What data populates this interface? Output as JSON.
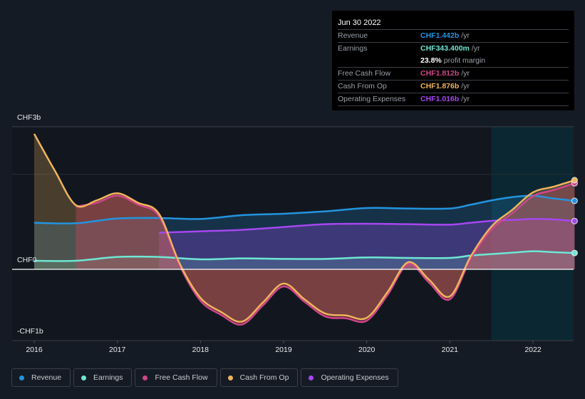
{
  "tooltip": {
    "date": "Jun 30 2022",
    "rows": [
      {
        "label": "Revenue",
        "value": "CHF1.442b",
        "unit": "/yr",
        "color": "#2394df"
      },
      {
        "label": "Earnings",
        "value": "CHF343.400m",
        "unit": "/yr",
        "color": "#6ee7d4"
      },
      {
        "label": "",
        "value": "23.8%",
        "unit": "profit margin",
        "color": "#ffffff"
      },
      {
        "label": "Free Cash Flow",
        "value": "CHF1.812b",
        "unit": "/yr",
        "color": "#d0468a"
      },
      {
        "label": "Cash From Op",
        "value": "CHF1.876b",
        "unit": "/yr",
        "color": "#f0b45c"
      },
      {
        "label": "Operating Expenses",
        "value": "CHF1.016b",
        "unit": "/yr",
        "color": "#a547f0"
      }
    ]
  },
  "chart_data": {
    "type": "area",
    "title": "",
    "xlabel": "",
    "ylabel": "",
    "y_tick_labels": [
      "CHF3b",
      "CHF0",
      "-CHF1b"
    ],
    "y_ticks": [
      3,
      0,
      -1
    ],
    "ylim": [
      -1.5,
      3
    ],
    "x_tick_labels": [
      "2016",
      "2017",
      "2018",
      "2019",
      "2020",
      "2021",
      "2022"
    ],
    "x_ticks": [
      2016,
      2017,
      2018,
      2019,
      2020,
      2021,
      2022
    ],
    "xlim": [
      2015.7,
      2022.5
    ],
    "grid": true,
    "legend_position": "bottom",
    "highlight_start": 2021.5,
    "unit": "CHF billions",
    "series": [
      {
        "name": "Revenue",
        "color": "#2394df",
        "start": 2016.0,
        "x": [
          2016.0,
          2016.5,
          2017.0,
          2017.5,
          2018.0,
          2018.5,
          2019.0,
          2019.5,
          2020.0,
          2020.5,
          2021.0,
          2021.25,
          2021.5,
          2021.75,
          2022.0,
          2022.25,
          2022.5
        ],
        "values": [
          0.98,
          0.97,
          1.07,
          1.08,
          1.06,
          1.14,
          1.17,
          1.22,
          1.29,
          1.28,
          1.28,
          1.36,
          1.45,
          1.52,
          1.55,
          1.49,
          1.442
        ]
      },
      {
        "name": "Earnings",
        "color": "#6ee7d4",
        "start": 2016.0,
        "x": [
          2016.0,
          2016.5,
          2017.0,
          2017.5,
          2018.0,
          2018.5,
          2019.0,
          2019.5,
          2020.0,
          2020.5,
          2021.0,
          2021.25,
          2021.5,
          2021.75,
          2022.0,
          2022.25,
          2022.5
        ],
        "values": [
          0.18,
          0.18,
          0.26,
          0.26,
          0.21,
          0.23,
          0.22,
          0.22,
          0.25,
          0.24,
          0.24,
          0.29,
          0.32,
          0.35,
          0.38,
          0.36,
          0.3434
        ]
      },
      {
        "name": "Free Cash Flow",
        "color": "#d0468a",
        "start": 2016.5,
        "x": [
          2016.5,
          2016.75,
          2017.0,
          2017.25,
          2017.5,
          2017.75,
          2018.0,
          2018.25,
          2018.5,
          2018.75,
          2019.0,
          2019.25,
          2019.5,
          2019.75,
          2020.0,
          2020.25,
          2020.5,
          2020.75,
          2021.0,
          2021.25,
          2021.5,
          2021.75,
          2022.0,
          2022.25,
          2022.5
        ],
        "values": [
          1.32,
          1.4,
          1.55,
          1.36,
          1.12,
          0.08,
          -0.66,
          -0.96,
          -1.16,
          -0.76,
          -0.36,
          -0.68,
          -0.99,
          -1.03,
          -1.08,
          -0.54,
          0.11,
          -0.28,
          -0.63,
          0.22,
          0.84,
          1.18,
          1.54,
          1.67,
          1.812
        ]
      },
      {
        "name": "Cash From Op",
        "color": "#f0b45c",
        "start": 2016.0,
        "x": [
          2016.0,
          2016.25,
          2016.5,
          2016.75,
          2017.0,
          2017.25,
          2017.5,
          2017.75,
          2018.0,
          2018.25,
          2018.5,
          2018.75,
          2019.0,
          2019.25,
          2019.5,
          2019.75,
          2020.0,
          2020.25,
          2020.5,
          2020.75,
          2021.0,
          2021.25,
          2021.5,
          2021.75,
          2022.0,
          2022.25,
          2022.5
        ],
        "values": [
          2.85,
          2.07,
          1.35,
          1.45,
          1.6,
          1.4,
          1.17,
          0.12,
          -0.6,
          -0.9,
          -1.1,
          -0.7,
          -0.3,
          -0.63,
          -0.93,
          -0.97,
          -1.02,
          -0.48,
          0.15,
          -0.22,
          -0.57,
          0.27,
          0.9,
          1.25,
          1.62,
          1.74,
          1.876
        ]
      },
      {
        "name": "Operating Expenses",
        "color": "#a547f0",
        "start": 2017.5,
        "x": [
          2017.5,
          2018.0,
          2018.5,
          2019.0,
          2019.5,
          2020.0,
          2020.5,
          2021.0,
          2021.25,
          2021.5,
          2021.75,
          2022.0,
          2022.25,
          2022.5
        ],
        "values": [
          0.77,
          0.8,
          0.83,
          0.89,
          0.95,
          0.96,
          0.95,
          0.94,
          0.98,
          1.02,
          1.04,
          1.06,
          1.05,
          1.016
        ]
      }
    ]
  },
  "legend": [
    {
      "label": "Revenue",
      "color": "#2394df"
    },
    {
      "label": "Earnings",
      "color": "#6ee7d4"
    },
    {
      "label": "Free Cash Flow",
      "color": "#d0468a"
    },
    {
      "label": "Cash From Op",
      "color": "#f0b45c"
    },
    {
      "label": "Operating Expenses",
      "color": "#a547f0"
    }
  ]
}
